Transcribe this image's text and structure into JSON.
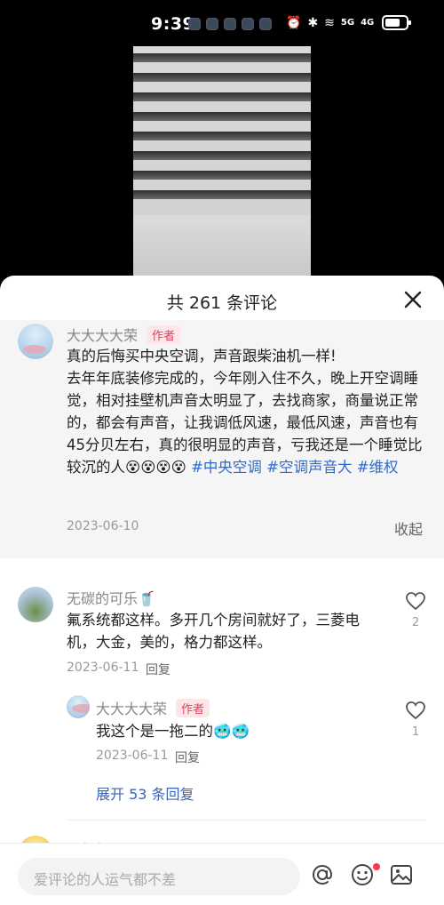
{
  "status": {
    "time": "9:39",
    "signal1": "5G",
    "signal2": "4G"
  },
  "sheet": {
    "title": "共 261 条评论"
  },
  "author_comment": {
    "name": "大大大大荣",
    "tag": "作者",
    "line1": "真的后悔买中央空调，声音跟柴油机一样!",
    "body": "去年年底装修完成的，今年刚入住不久，晚上开空调睡觉，相对挂壁机声音太明显了，去找商家，商量说正常的，都会有声音，让我调低风速，最低风速，声音也有45分贝左右，真的很明显的声音，亏我还是一个睡觉比较沉的人",
    "emojis": "😵😵😵😵",
    "hashtags": [
      "#中央空调",
      "#空调声音大",
      "#维权"
    ],
    "date": "2023-06-10",
    "collapse": "收起"
  },
  "comments": [
    {
      "name": "无碳的可乐🥤",
      "text": "氟系统都这样。多开几个房间就好了，三菱电机，大金，美的，格力都这样。",
      "date": "2023-06-11",
      "reply": "回复",
      "likes": "2"
    }
  ],
  "reply": {
    "name": "大大大大荣",
    "tag": "作者",
    "text": "我这个是一拖二的🥶🥶",
    "date": "2023-06-11",
    "reply": "回复",
    "likes": "1",
    "expand": "展开 53 条回复"
  },
  "next_comment": {
    "name": "凤年年"
  },
  "input": {
    "placeholder": "爱评论的人运气都不差"
  },
  "colors": {
    "hashtag": "#2f6bcf",
    "author_tag": "#e0405a",
    "notification_dot": "#ff3355"
  }
}
